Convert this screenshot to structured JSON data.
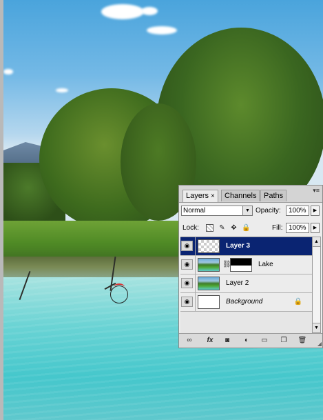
{
  "layers_panel": {
    "tabs": [
      {
        "label": "Layers",
        "active": true,
        "close": "×"
      },
      {
        "label": "Channels",
        "active": false
      },
      {
        "label": "Paths",
        "active": false
      }
    ],
    "panel_menu_glyph": "▾≡",
    "blend_mode": "Normal",
    "opacity_label": "Opacity:",
    "opacity_value": "100%",
    "lock_label": "Lock:",
    "fill_label": "Fill:",
    "fill_value": "100%",
    "layers": [
      {
        "name": "Layer 3",
        "selected": true,
        "thumb": "transparent"
      },
      {
        "name": "Lake",
        "selected": false,
        "thumb": "photo",
        "has_mask": true
      },
      {
        "name": "Layer 2",
        "selected": false,
        "thumb": "photo"
      },
      {
        "name": "Background",
        "selected": false,
        "thumb": "white",
        "locked": true
      }
    ],
    "footer_buttons": [
      "link-icon",
      "fx-icon",
      "mask-icon",
      "adjustment-icon",
      "folder-icon",
      "new-layer-icon",
      "trash-icon"
    ],
    "footer_fx_label": "fx"
  },
  "colors": {
    "selected_layer_bg": "#0a2472",
    "water": "#45c7cc",
    "sky": "#4aa4dc"
  }
}
